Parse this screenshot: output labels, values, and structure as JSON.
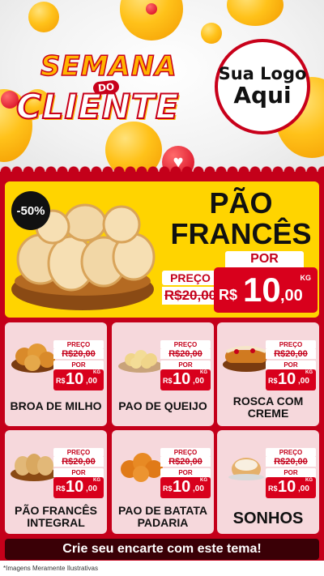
{
  "header": {
    "campaign_line1": "SEMANA",
    "campaign_line2": "DO",
    "campaign_line3": "CLIENTE",
    "logo_line1": "Sua Logo",
    "logo_line2": "Aqui"
  },
  "featured": {
    "discount_badge": "-50%",
    "title_line1": "PÃO",
    "title_line2": "FRANCÊS",
    "price_label": "PREÇO",
    "old_price": "R$20,00",
    "por_label": "POR",
    "currency": "R$",
    "new_price_int": "10",
    "new_price_dec": ",00",
    "unit": "KG"
  },
  "products": [
    {
      "name": "BROA DE MILHO",
      "price_label": "PREÇO",
      "old_price": "R$20,00",
      "por_label": "POR",
      "currency": "R$",
      "new_int": "10",
      "new_dec": ",00",
      "unit": "KG"
    },
    {
      "name": "PAO DE QUEIJO",
      "price_label": "PREÇO",
      "old_price": "R$20,00",
      "por_label": "POR",
      "currency": "R$",
      "new_int": "10",
      "new_dec": ",00",
      "unit": "KG"
    },
    {
      "name": "ROSCA COM CREME",
      "price_label": "PREÇO",
      "old_price": "R$20,00",
      "por_label": "POR",
      "currency": "R$",
      "new_int": "10",
      "new_dec": ",00",
      "unit": "KG"
    },
    {
      "name": "PÃO FRANCÊS INTEGRAL",
      "price_label": "PREÇO",
      "old_price": "R$20,00",
      "por_label": "POR",
      "currency": "R$",
      "new_int": "10",
      "new_dec": ",00",
      "unit": "KG"
    },
    {
      "name": "PAO DE BATATA PADARIA",
      "price_label": "PREÇO",
      "old_price": "R$20,00",
      "por_label": "POR",
      "currency": "R$",
      "new_int": "10",
      "new_dec": ",00",
      "unit": "KG"
    },
    {
      "name": "SONHOS",
      "price_label": "PREÇO",
      "old_price": "R$20,00",
      "por_label": "POR",
      "currency": "R$",
      "new_int": "10",
      "new_dec": ",00",
      "unit": "KG"
    }
  ],
  "cta": {
    "label": "Crie seu encarte com este tema!"
  },
  "footer": {
    "disclaimer": "*Imagens Meramente Ilustrativas"
  },
  "colors": {
    "brand_red": "#c4001a",
    "accent_yellow": "#ffd400",
    "cta_dark": "#3a0006"
  }
}
